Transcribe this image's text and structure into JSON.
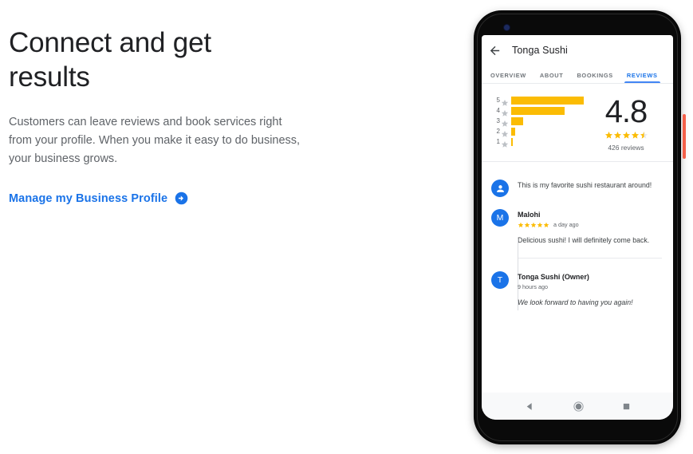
{
  "left": {
    "headline": "Connect and get results",
    "body": "Customers can leave reviews and book services right from your profile. When you make it easy to do business, your business grows.",
    "cta_label": "Manage my Business Profile"
  },
  "phone": {
    "app_bar": {
      "title": "Tonga Sushi",
      "back_icon": "back-arrow-icon"
    },
    "tabs": [
      {
        "label": "OVERVIEW",
        "active": false
      },
      {
        "label": "ABOUT",
        "active": false
      },
      {
        "label": "BOOKINGS",
        "active": false
      },
      {
        "label": "REVIEWS",
        "active": true
      }
    ],
    "rating": {
      "score": "4.8",
      "stars_filled": 4.5,
      "review_count": "426 reviews",
      "histogram": [
        {
          "label": "5",
          "pct": 100
        },
        {
          "label": "4",
          "pct": 74
        },
        {
          "label": "3",
          "pct": 16
        },
        {
          "label": "2",
          "pct": 5
        },
        {
          "label": "1",
          "pct": 1
        }
      ]
    },
    "reviews": [
      {
        "avatar_type": "person-icon",
        "avatar_letter": "",
        "text": "This is my favorite sushi restaurant around!"
      },
      {
        "avatar_type": "letter",
        "avatar_letter": "M",
        "author": "Malohi",
        "stars": 5,
        "time": "a day ago",
        "comment": "Delicious sushi! I will definitely come back."
      }
    ],
    "owner_reply": {
      "avatar_letter": "T",
      "author": "Tonga Sushi (Owner)",
      "time": "9 hours ago",
      "comment": "We look forward to having you again!"
    },
    "nav": [
      {
        "icon": "back-triangle-icon"
      },
      {
        "icon": "home-circle-icon"
      },
      {
        "icon": "recents-square-icon"
      }
    ]
  },
  "colors": {
    "accent_blue": "#1a73e8",
    "star_gold": "#fbbc04",
    "power_button_red": "#f4604a"
  }
}
